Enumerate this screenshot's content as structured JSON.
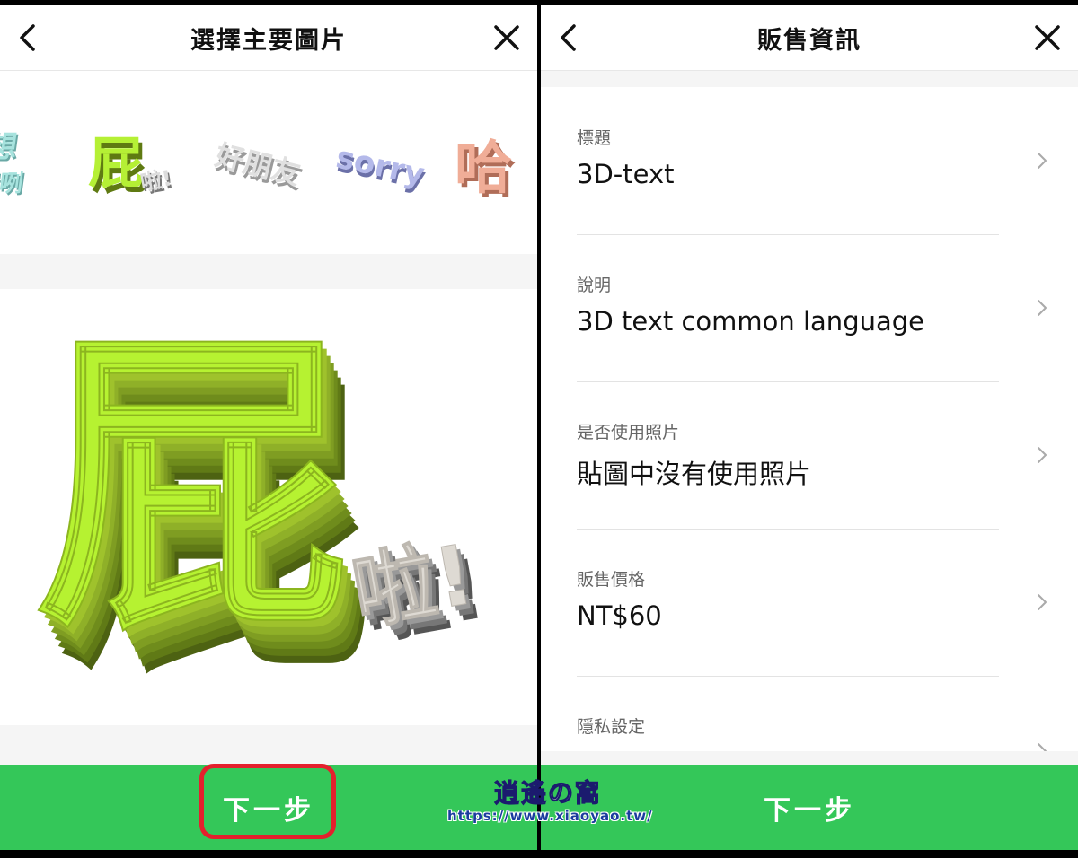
{
  "left_screen": {
    "title": "選擇主要圖片",
    "back_icon": "chevron-left-icon",
    "close_icon": "close-icon",
    "stickers": [
      {
        "name": "sticker-xiangni",
        "text": "想你喔咧",
        "color": "#8fd6d2"
      },
      {
        "name": "sticker-pi-la",
        "text": "屁啦!",
        "color": "#b5f035"
      },
      {
        "name": "sticker-haopengyou",
        "text": "好朋友",
        "color": "#d9d9d9"
      },
      {
        "name": "sticker-sorry",
        "text": "sorry",
        "color": "#a9aee0"
      },
      {
        "name": "sticker-ha",
        "text": "哈",
        "color": "#e9a28b"
      }
    ],
    "selected_sticker": {
      "main": "屁",
      "sub": "啦!",
      "main_color": "#b6f231",
      "sub_color": "#d8d5cf"
    },
    "next_button": "下一步",
    "watermark_url": "https://www.xiaoyao.tw/",
    "watermark_logo_text": "逍遙の窩"
  },
  "right_screen": {
    "title": "販售資訊",
    "back_icon": "chevron-left-icon",
    "close_icon": "close-icon",
    "rows": [
      {
        "label": "標題",
        "value": "3D-text"
      },
      {
        "label": "說明",
        "value": "3D text common language"
      },
      {
        "label": "是否使用照片",
        "value": "貼圖中沒有使用照片"
      },
      {
        "label": "販售價格",
        "value": "NT$60"
      },
      {
        "label": "隱私設定",
        "value": ""
      }
    ],
    "next_button": "下一步"
  },
  "colors": {
    "accent_green": "#34c759",
    "highlight_red": "#e4202d"
  }
}
